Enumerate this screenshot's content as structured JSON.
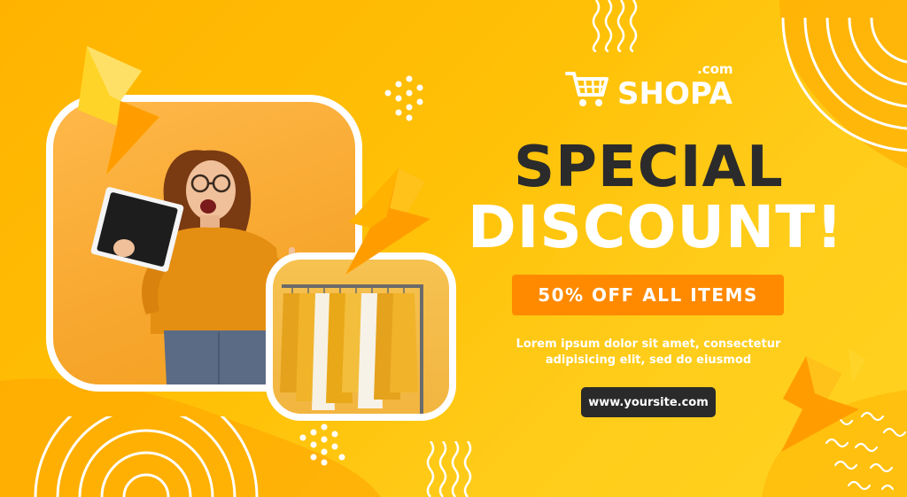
{
  "brand": {
    "name": "SHOPA",
    "suffix": ".com"
  },
  "headline": {
    "line1": "SPECIAL",
    "line2": "DISCOUNT!"
  },
  "offer": {
    "label": "50% OFF ALL ITEMS"
  },
  "description": {
    "line1": "Lorem ipsum dolor sit amet, consectetur",
    "line2": "adipisicing elit, sed do eiusmod"
  },
  "cta": {
    "label": "www.yoursite.com"
  },
  "colors": {
    "background": "#ffc107",
    "offer_badge": "#ff8a00",
    "headline_dark": "#2b2b2b",
    "button_dark": "#2a2a2a",
    "accent_white": "#ffffff"
  },
  "icons": [
    "shopping-cart-icon",
    "lightning-bolt-icon",
    "dot-cluster-icon",
    "wavy-lines-icon",
    "concentric-arcs-icon"
  ]
}
